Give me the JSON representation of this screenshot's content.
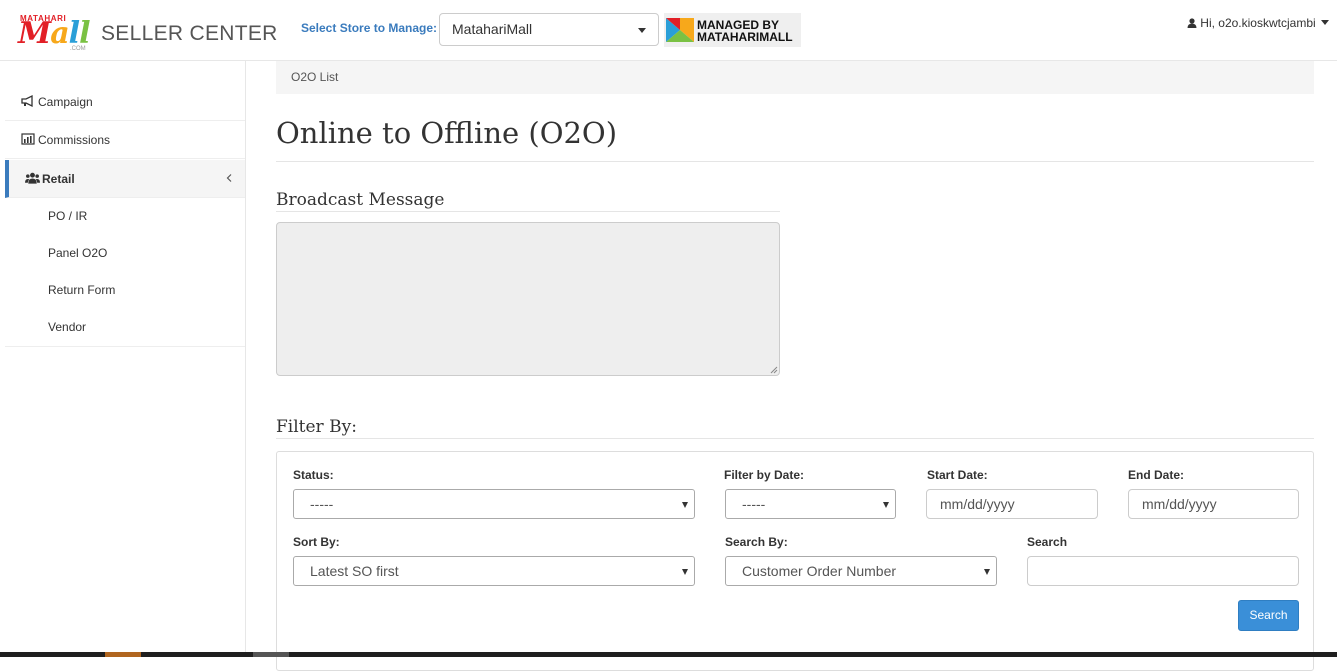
{
  "header": {
    "logo_small": "MATAHARI",
    "logo_mall": "Mall",
    "logo_com": ".COM",
    "brand": "SELLER CENTER",
    "store_label": "Select Store to Manage:",
    "store_selected": "MatahariMall",
    "managed_line1": "MANAGED BY",
    "managed_line2": "MATAHARIMALL",
    "user_greeting": "Hi, o2o.kioskwtcjambi"
  },
  "sidebar": {
    "items": [
      {
        "label": "Campaign",
        "icon": "bullhorn-icon"
      },
      {
        "label": "Commissions",
        "icon": "bar-chart-icon"
      },
      {
        "label": "Retail",
        "icon": "users-icon"
      }
    ],
    "sub_items": [
      "PO / IR",
      "Panel O2O",
      "Return Form",
      "Vendor"
    ]
  },
  "main": {
    "breadcrumb": "O2O List",
    "title": "Online to Offline (O2O)",
    "broadcast_title": "Broadcast Message",
    "filter_title": "Filter By:",
    "filters": {
      "status_label": "Status:",
      "status_value": "-----",
      "date_filter_label": "Filter by Date:",
      "date_filter_value": "-----",
      "start_date_label": "Start Date:",
      "start_date_placeholder": "mm/dd/yyyy",
      "end_date_label": "End Date:",
      "end_date_placeholder": "mm/dd/yyyy",
      "sort_label": "Sort By:",
      "sort_value": "Latest SO first",
      "search_by_label": "Search By:",
      "search_by_value": "Customer Order Number",
      "search_label": "Search",
      "search_button": "Search"
    }
  },
  "colors": {
    "accent": "#3a7bbd",
    "button": "#3a8fd8"
  }
}
